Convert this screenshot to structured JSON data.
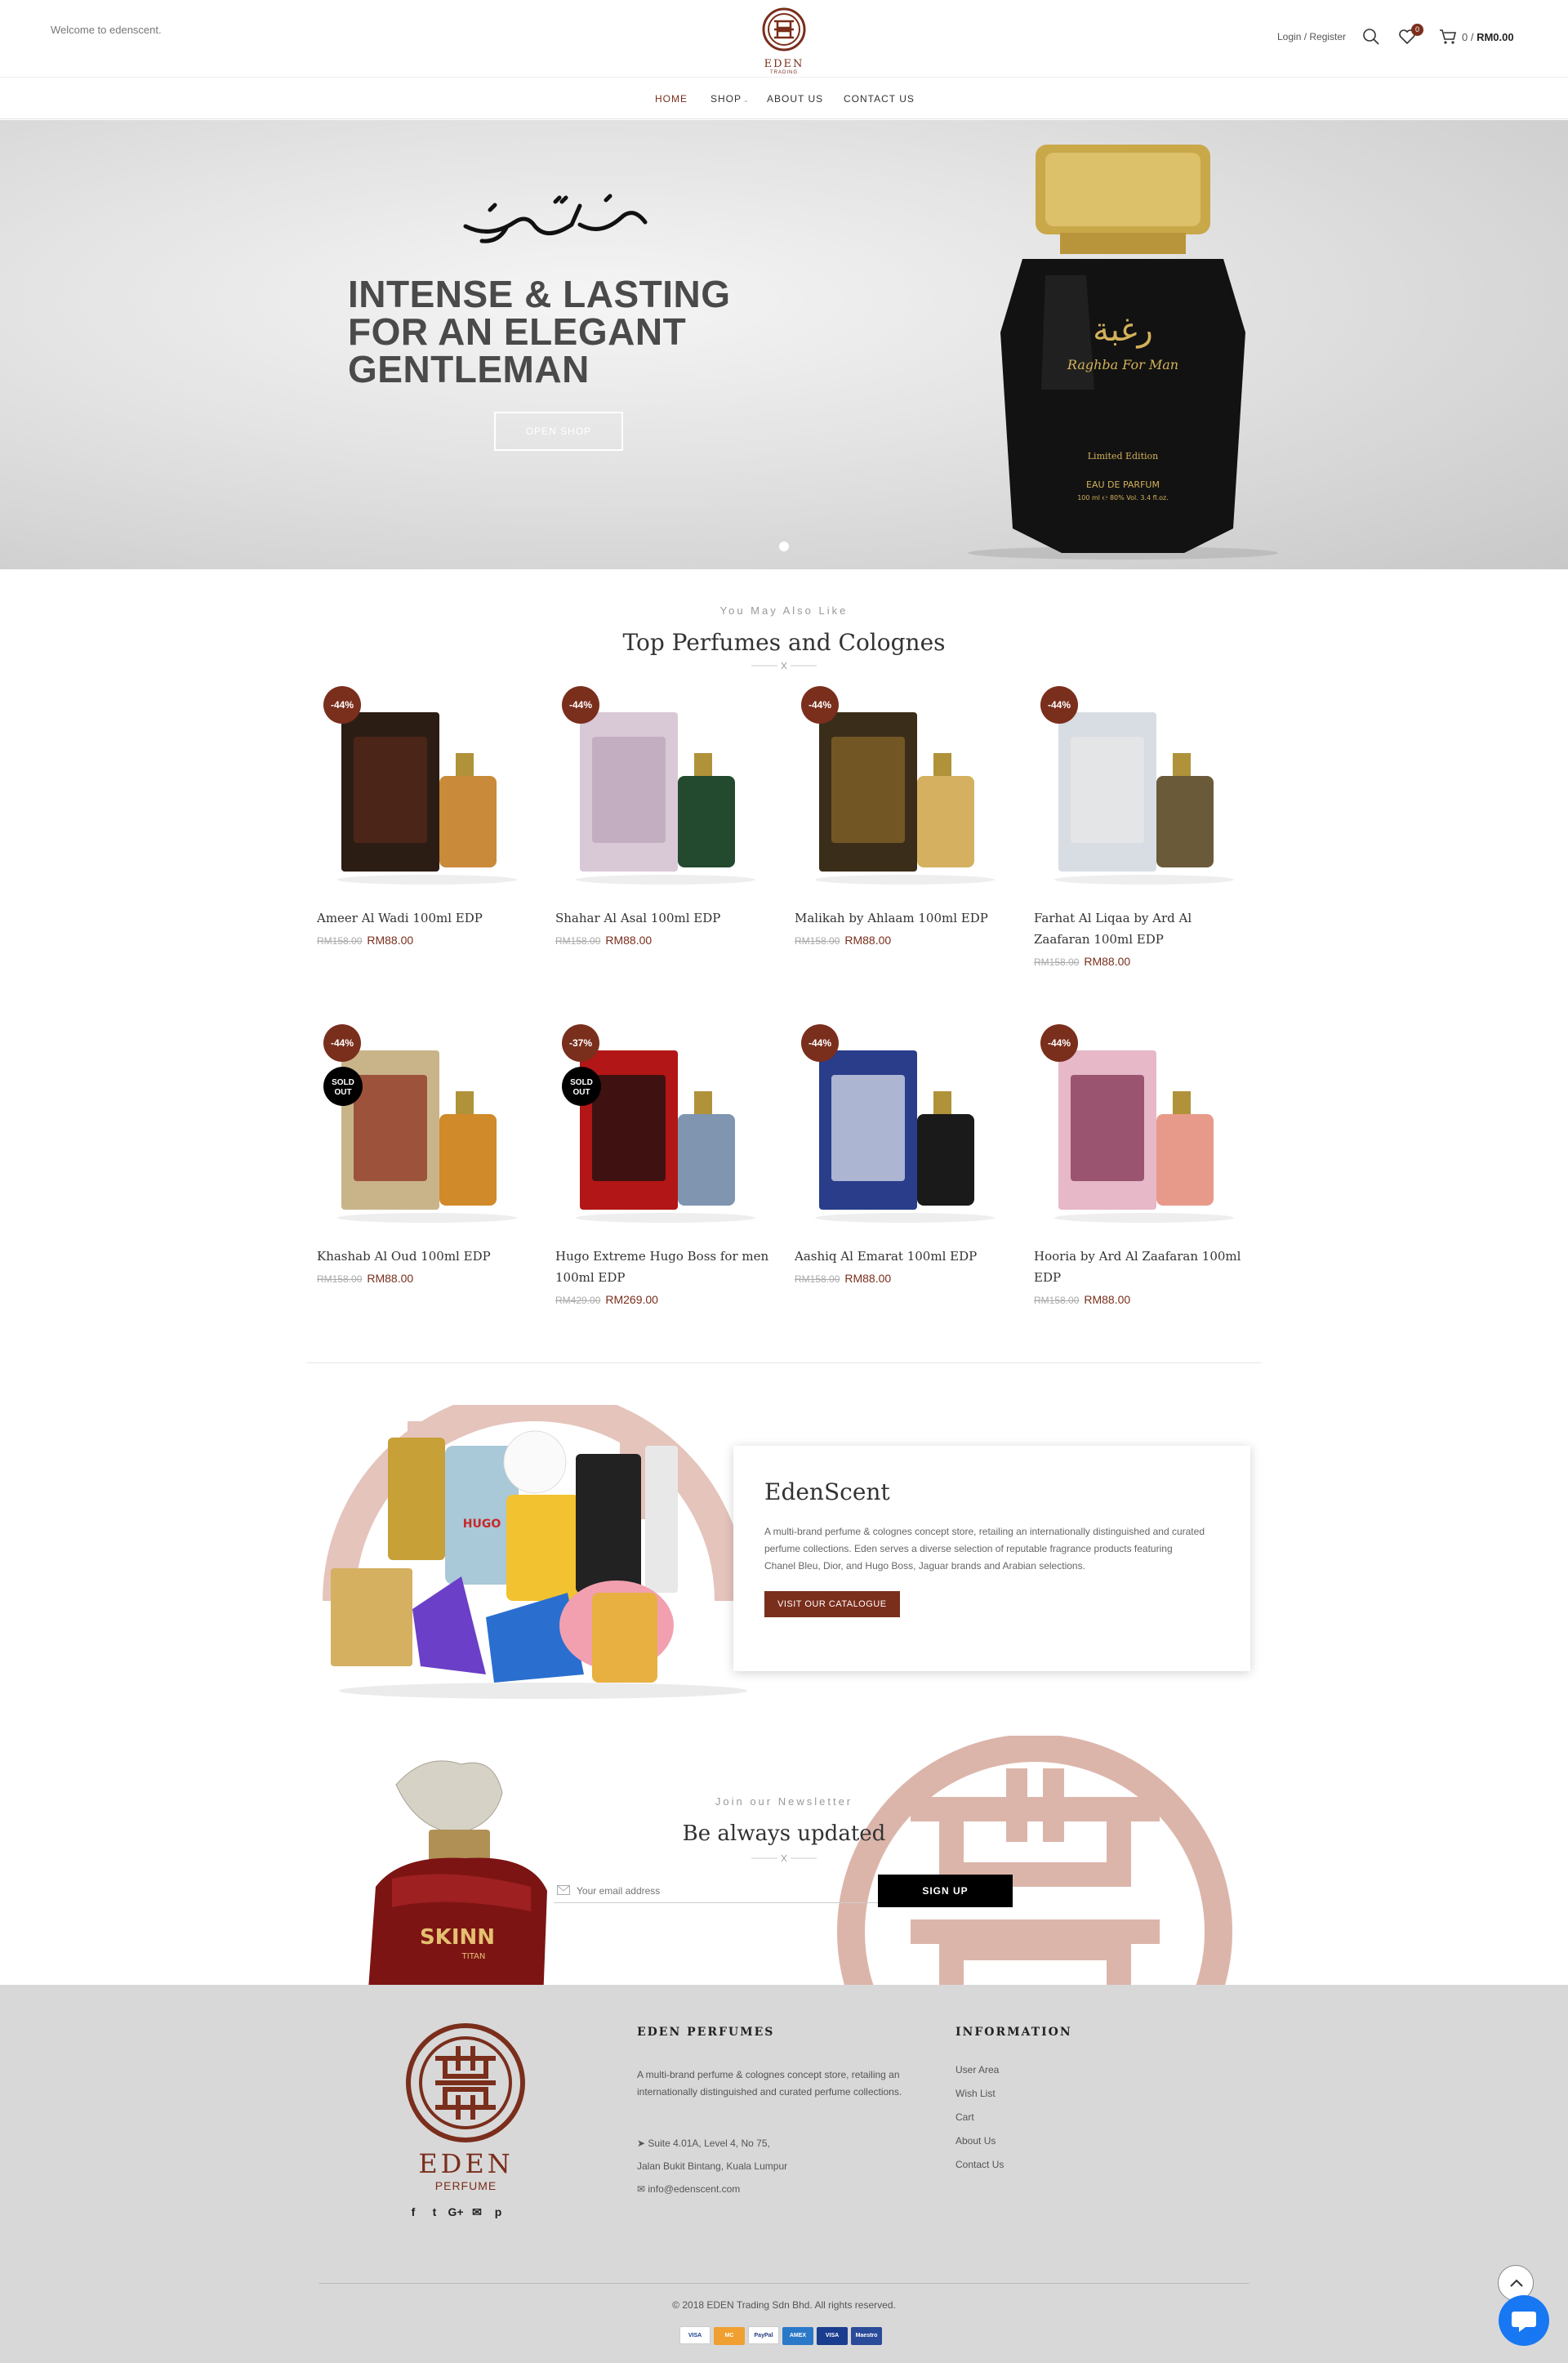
{
  "header": {
    "welcome": "Welcome to edenscent.",
    "logo_word": "EDEN",
    "logo_sub": "TRADING",
    "login": "Login / Register",
    "wishlist_count": "0",
    "cart_count": "0",
    "cart_sep": " / ",
    "cart_total": "RM0.00"
  },
  "nav": {
    "items": [
      "HOME",
      "SHOP",
      "ABOUT US",
      "CONTACT US"
    ]
  },
  "hero": {
    "title": "INTENSE & LASTING FOR AN ELEGANT GENTLEMAN",
    "button": "OPEN SHOP",
    "bottle_line1": "Raghba For Man",
    "bottle_line2": "Limited Edition",
    "bottle_line3": "EAU DE PARFUM",
    "bottle_line4": "100 ml ℮ 80% Vol. 3.4 fl.oz."
  },
  "products_section": {
    "subtitle": "You May Also Like",
    "title": "Top Perfumes and Colognes"
  },
  "products": [
    {
      "name": "Ameer Al Wadi 100ml EDP",
      "old_price": "RM158.00",
      "price": "RM88.00",
      "badge": "-44%",
      "sold_out": ""
    },
    {
      "name": "Shahar Al Asal 100ml EDP",
      "old_price": "RM158.00",
      "price": "RM88.00",
      "badge": "-44%",
      "sold_out": ""
    },
    {
      "name": "Malikah by Ahlaam 100ml EDP",
      "old_price": "RM158.00",
      "price": "RM88.00",
      "badge": "-44%",
      "sold_out": ""
    },
    {
      "name": "Farhat Al Liqaa by Ard Al Zaafaran 100ml EDP",
      "old_price": "RM158.00",
      "price": "RM88.00",
      "badge": "-44%",
      "sold_out": ""
    },
    {
      "name": "Khashab Al Oud 100ml EDP",
      "old_price": "RM158.00",
      "price": "RM88.00",
      "badge": "-44%",
      "sold_out": "SOLD OUT"
    },
    {
      "name": "Hugo Extreme Hugo Boss for men 100ml EDP",
      "old_price": "RM429.00",
      "price": "RM269.00",
      "badge": "-37%",
      "sold_out": "SOLD OUT"
    },
    {
      "name": "Aashiq Al Emarat 100ml EDP",
      "old_price": "RM158.00",
      "price": "RM88.00",
      "badge": "-44%",
      "sold_out": ""
    },
    {
      "name": "Hooria by Ard Al Zaafaran 100ml EDP",
      "old_price": "RM158.00",
      "price": "RM88.00",
      "badge": "-44%",
      "sold_out": ""
    }
  ],
  "about": {
    "title": "EdenScent",
    "text": "A multi-brand perfume & colognes concept store, retailing an internationally distinguished and curated perfume collections. Eden serves a diverse selection of reputable fragrance products featuring Chanel Bleu, Dior, and Hugo Boss, Jaguar brands and Arabian selections.",
    "button": "VISIT OUR CATALOGUE"
  },
  "newsletter": {
    "subtitle": "Join our Newsletter",
    "title": "Be always updated",
    "placeholder": "Your email address",
    "button": "SIGN UP"
  },
  "footer": {
    "logo_word": "EDEN",
    "logo_sub": "PERFUME",
    "col1_title": "EDEN PERFUMES",
    "desc": "A multi-brand perfume & colognes concept store, retailing an internationally distinguished and curated perfume collections.",
    "address1": "Suite 4.01A, Level 4, No 75,",
    "address2": "Jalan Bukit Bintang, Kuala Lumpur",
    "email": "info@edenscent.com",
    "col2_title": "INFORMATION",
    "links": [
      "User Area",
      "Wish List",
      "Cart",
      "About Us",
      "Contact Us"
    ],
    "copyright": "© 2018 EDEN Trading Sdn Bhd. All rights reserved.",
    "socials": [
      "f",
      "t",
      "G+",
      "✉",
      "p"
    ],
    "payments": [
      "VISA",
      "MC",
      "PayPal",
      "AMEX",
      "VISA",
      "Maestro"
    ]
  },
  "colors": {
    "accent": "#7a2e1c",
    "footer_bg": "#d8d8d8",
    "chat": "#1877f2"
  },
  "icons": [
    "search-icon",
    "heart-icon",
    "cart-icon",
    "mail-icon",
    "location-icon",
    "envelope-icon",
    "chevron-up-icon",
    "chat-icon"
  ]
}
